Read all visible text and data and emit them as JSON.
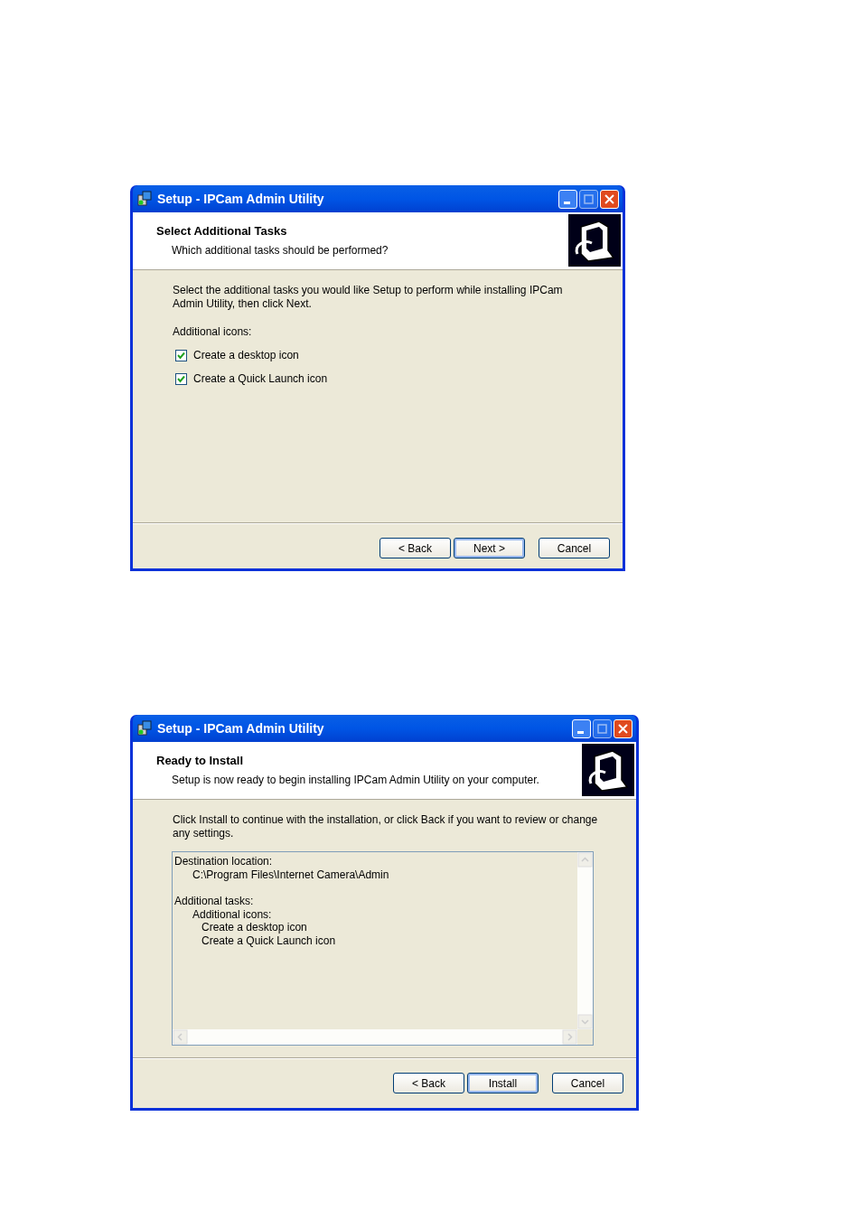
{
  "dialogs": [
    {
      "kind": "tasks",
      "title": "Setup - IPCam Admin Utility",
      "heading": "Select Additional Tasks",
      "subheading": "Which additional tasks should be performed?",
      "intro": "Select the additional tasks you would like Setup to perform while installing IPCam Admin Utility, then click Next.",
      "group_label": "Additional icons:",
      "options": [
        {
          "label": "Create a desktop icon",
          "checked": true
        },
        {
          "label": "Create a Quick Launch icon",
          "checked": true
        }
      ],
      "buttons": [
        {
          "label": "< Back",
          "default": false
        },
        {
          "label": "Next >",
          "default": true
        },
        {
          "label": "Cancel",
          "default": false
        }
      ]
    },
    {
      "kind": "summary",
      "title": "Setup - IPCam Admin Utility",
      "heading": "Ready to Install",
      "subheading": "Setup is now ready to begin installing IPCam Admin Utility on your computer.",
      "intro": "Click Install to continue with the installation, or click Back if you want to review or change any settings.",
      "memo": [
        {
          "text": "Destination location:",
          "children": [
            {
              "text": "C:\\Program Files\\Internet Camera\\Admin"
            }
          ]
        },
        {
          "text": "Additional tasks:",
          "children": [
            {
              "text": "Additional icons:",
              "children": [
                {
                  "text": "Create a desktop icon"
                },
                {
                  "text": "Create a Quick Launch icon"
                }
              ]
            }
          ]
        }
      ],
      "buttons": [
        {
          "label": "< Back",
          "default": false
        },
        {
          "label": "Install",
          "default": true
        },
        {
          "label": "Cancel",
          "default": false
        }
      ]
    }
  ]
}
